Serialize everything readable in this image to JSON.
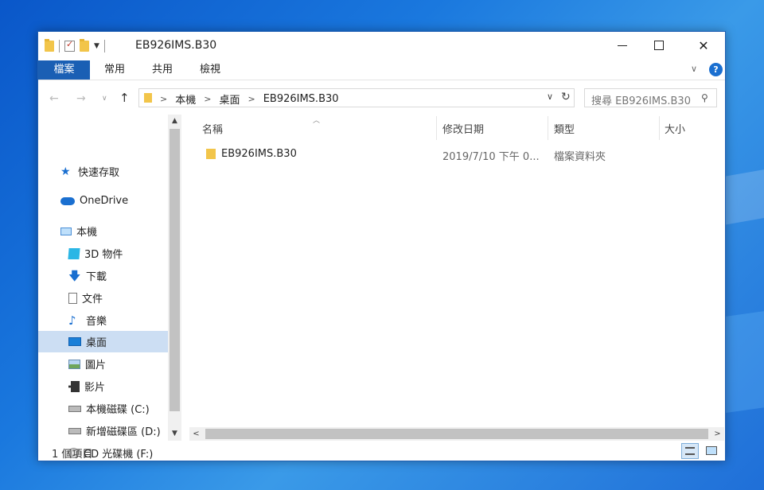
{
  "window": {
    "title": "EB926IMS.B30"
  },
  "ribbon": {
    "tabs": [
      "檔案",
      "常用",
      "共用",
      "檢視"
    ],
    "help": "?"
  },
  "address": {
    "path": [
      "本機",
      "桌面",
      "EB926IMS.B30"
    ]
  },
  "search": {
    "placeholder": "搜尋 EB926IMS.B30"
  },
  "nav_pane": {
    "items": [
      {
        "label": "快速存取",
        "icon": "star-icon"
      },
      {
        "label": "OneDrive",
        "icon": "cloud-icon"
      },
      {
        "label": "本機",
        "icon": "computer-icon"
      },
      {
        "label": "3D 物件",
        "icon": "cube-icon"
      },
      {
        "label": "下載",
        "icon": "download-icon"
      },
      {
        "label": "文件",
        "icon": "document-icon"
      },
      {
        "label": "音樂",
        "icon": "music-icon"
      },
      {
        "label": "桌面",
        "icon": "desktop-icon",
        "selected": true
      },
      {
        "label": "圖片",
        "icon": "picture-icon"
      },
      {
        "label": "影片",
        "icon": "video-icon"
      },
      {
        "label": "本機磁碟 (C:)",
        "icon": "drive-icon"
      },
      {
        "label": "新增磁碟區 (D:)",
        "icon": "drive-icon"
      },
      {
        "label": "CD 光碟機 (F:)",
        "icon": "cd-icon"
      }
    ]
  },
  "columns": [
    "名稱",
    "修改日期",
    "類型",
    "大小"
  ],
  "files": [
    {
      "name": "EB926IMS.B30",
      "modified": "2019/7/10 下午 0...",
      "type": "檔案資料夾",
      "size": ""
    }
  ],
  "status": {
    "count": "1 個項目"
  }
}
